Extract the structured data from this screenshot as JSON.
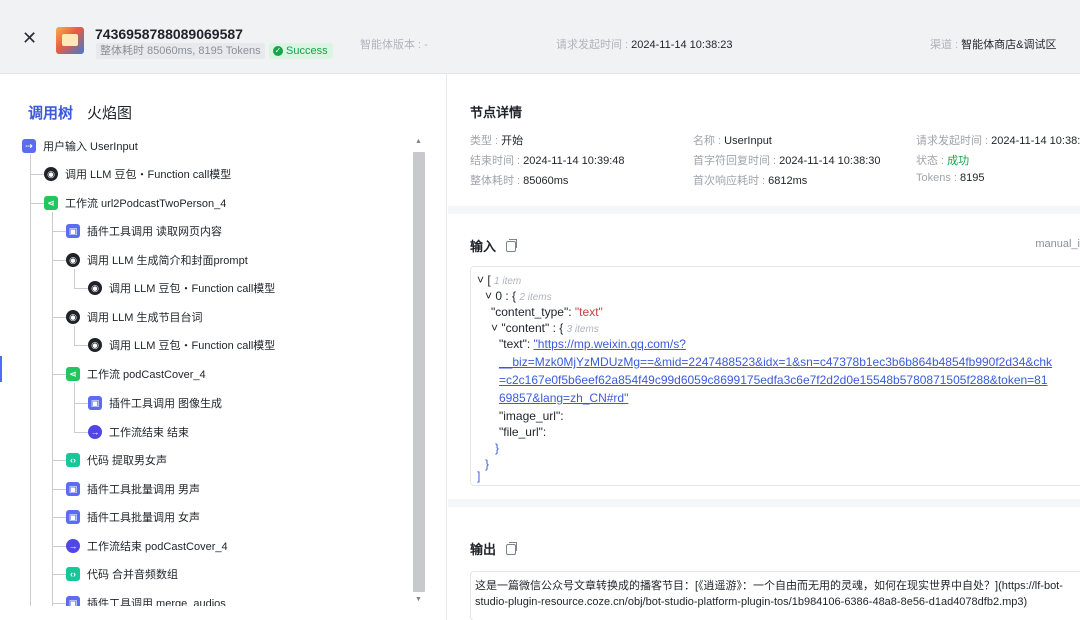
{
  "header": {
    "close_icon": "close-icon",
    "record_id": "7436958788089069587",
    "meta": "整体耗时 85060ms, 8195 Tokens",
    "status": "Success",
    "version_label": "智能体版本 : -",
    "request_time_label": "请求发起时间 : ",
    "request_time": "2024-11-14 10:38:23",
    "channel_label": "渠道 : ",
    "channel": "智能体商店&调试区"
  },
  "left": {
    "tabs": [
      {
        "label": "调用树",
        "active": true
      },
      {
        "label": "火焰图",
        "active": false
      }
    ],
    "tree": [
      {
        "icon": "user",
        "label": "用户输入 UserInput"
      },
      {
        "icon": "llm",
        "label": "调用 LLM 豆包・Function call模型"
      },
      {
        "icon": "wf",
        "label": "工作流 url2PodcastTwoPerson_4"
      },
      {
        "icon": "plug",
        "label": "插件工具调用 读取网页内容"
      },
      {
        "icon": "llm",
        "label": "调用 LLM 生成简介和封面prompt"
      },
      {
        "icon": "llm",
        "label": "调用 LLM 豆包・Function call模型"
      },
      {
        "icon": "llm",
        "label": "调用 LLM 生成节目台词"
      },
      {
        "icon": "llm",
        "label": "调用 LLM 豆包・Function call模型"
      },
      {
        "icon": "wf",
        "label": "工作流 podCastCover_4"
      },
      {
        "icon": "plug",
        "label": "插件工具调用 图像生成"
      },
      {
        "icon": "end",
        "label": "工作流结束 结束"
      },
      {
        "icon": "code",
        "label": "代码 提取男女声"
      },
      {
        "icon": "plug",
        "label": "插件工具批量调用 男声"
      },
      {
        "icon": "plug",
        "label": "插件工具批量调用 女声"
      },
      {
        "icon": "end",
        "label": "工作流结束 podCastCover_4"
      },
      {
        "icon": "code",
        "label": "代码 合并音频数组"
      },
      {
        "icon": "plug",
        "label": "插件工具调用 merge_audios"
      }
    ]
  },
  "detail": {
    "title": "节点详情",
    "type_label": "类型 : ",
    "type": "开始",
    "name_label": "名称 : ",
    "name": "UserInput",
    "req_label": "请求发起时间 : ",
    "req": "2024-11-14 10:38:2",
    "end_label": "结束时间 : ",
    "end": "2024-11-14 10:39:48",
    "first_label": "首字符回复时间 : ",
    "first": "2024-11-14 10:38:30",
    "state_label": "状态 : ",
    "state": "成功",
    "total_label": "整体耗时 : ",
    "total": "85060ms",
    "resp_label": "首次响应耗时 : ",
    "resp": "6812ms",
    "tokens_label": "Tokens : ",
    "tokens": "8195"
  },
  "input": {
    "title": "输入",
    "tag": "manual_i",
    "json": {
      "root_meta": "1 item",
      "item_key": "0",
      "item_meta": "2 items",
      "content_type_key": "\"content_type\"",
      "content_type_val": "\"text\"",
      "content_key": "\"content\"",
      "content_meta": "3 items",
      "text_key": "\"text\"",
      "text_url_1": "\"https://mp.weixin.qq.com/s?",
      "text_url_2": "__biz=Mzk0MjYzMDUzMg==&mid=2247488523&idx=1&sn=c47378b1ec3b6b864b4854fb990f2d34&chk",
      "text_url_3": "=c2c167e0f5b6eef62a854f49c99d6059c8699175edfa3c6e7f2d2d0e15548b5780871505f288&token=81",
      "text_url_4": "69857&lang=zh_CN#rd\"",
      "image_key": "\"image_url\"",
      "file_key": "\"file_url\""
    }
  },
  "output": {
    "title": "输出",
    "text": "这是一篇微信公众号文章转换成的播客节目：[《逍遥游》：一个自由而无用的灵魂，如何在现实世界中自处？](https://lf-bot-studio-plugin-resource.coze.cn/obj/bot-studio-platform-plugin-tos/1b984106-6386-48a8-8e56-d1ad4078dfb2.mp3)"
  },
  "colors": {
    "accent": "#3b5bdb",
    "success": "#16a34a",
    "string": "#c2413c"
  }
}
